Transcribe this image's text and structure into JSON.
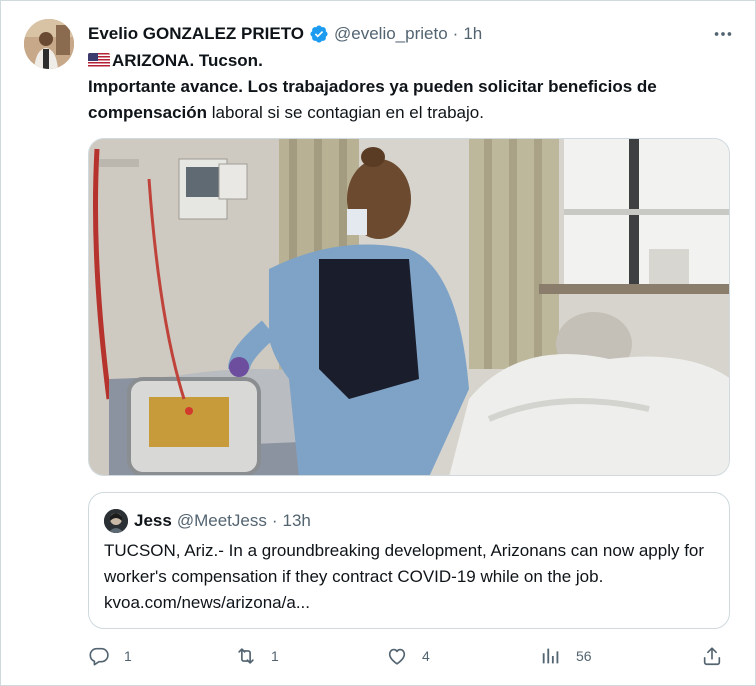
{
  "author": {
    "name": "Evelio GONZALEZ PRIETO",
    "handle": "@evelio_prieto",
    "separator": "·",
    "time": "1h"
  },
  "tweet": {
    "line1": "ARIZONA. Tucson.",
    "bold_part": "Importante avance. Los trabajadores ya pueden solicitar beneficios de compensación",
    "regular_part": " laboral si se contagian en el trabajo."
  },
  "quote": {
    "name": "Jess",
    "handle": "@MeetJess",
    "separator": "·",
    "time": "13h",
    "text": "TUCSON, Ariz.- In a groundbreaking development, Arizonans can now apply for worker's compensation if they contract COVID-19 while on the job. kvoa.com/news/arizona/a..."
  },
  "actions": {
    "replies": "1",
    "reposts": "1",
    "likes": "4",
    "views": "56"
  },
  "colors": {
    "verified": "#1d9bf0",
    "muted_text": "#536471",
    "border": "#cfd9de"
  },
  "icons": [
    "verified-badge-icon",
    "more-icon",
    "us-flag-icon",
    "reply-icon",
    "repost-icon",
    "like-icon",
    "views-icon",
    "share-icon"
  ]
}
